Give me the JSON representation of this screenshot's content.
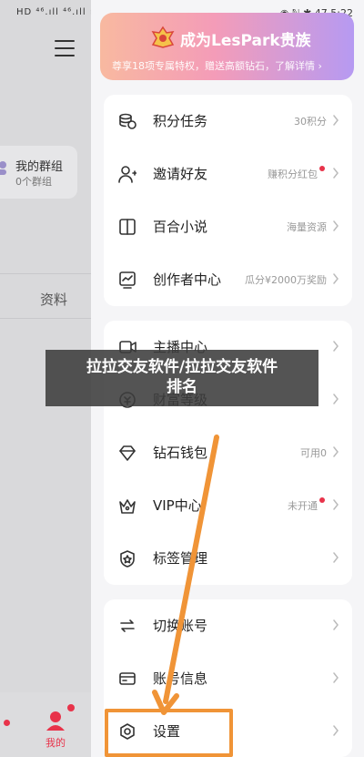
{
  "status_bar": {
    "left": "HD ⁴⁶.ıll ⁴⁶.ıll ≋ ▣",
    "right": "◉ ℕ ✱ 47 5:22"
  },
  "left_panel": {
    "group_title": "我的群组",
    "group_sub": "0个群组",
    "tab_label": "资料",
    "nav_label": "我的"
  },
  "vip_banner": {
    "title": "成为LesPark贵族",
    "subtitle": "尊享18项专属特权，赠送高额钻石，了解详情 ›"
  },
  "menu_sections": [
    [
      {
        "label": "积分任务",
        "value": "30积分",
        "icon": "coins-icon",
        "dot": false
      },
      {
        "label": "邀请好友",
        "value": "赚积分红包",
        "icon": "invite-user-icon",
        "dot": true
      },
      {
        "label": "百合小说",
        "value": "海量资源",
        "icon": "book-icon",
        "dot": false
      },
      {
        "label": "创作者中心",
        "value": "瓜分¥2000万奖励",
        "icon": "chart-icon",
        "dot": false
      }
    ],
    [
      {
        "label": "主播中心",
        "value": "",
        "icon": "video-icon",
        "dot": false
      },
      {
        "label": "财富等级",
        "value": "",
        "icon": "wealth-icon",
        "dot": false
      },
      {
        "label": "钻石钱包",
        "value": "可用0",
        "icon": "diamond-icon",
        "dot": false
      },
      {
        "label": "VIP中心",
        "value": "未开通",
        "icon": "crown-icon",
        "dot": true
      },
      {
        "label": "标签管理",
        "value": "",
        "icon": "tag-icon",
        "dot": false
      }
    ],
    [
      {
        "label": "切换账号",
        "value": "",
        "icon": "switch-icon",
        "dot": false
      },
      {
        "label": "账号信息",
        "value": "",
        "icon": "card-icon",
        "dot": false
      },
      {
        "label": "设置",
        "value": "",
        "icon": "settings-icon",
        "dot": false
      }
    ]
  ],
  "caption": {
    "line1": "拉拉交友软件/拉拉交友软件",
    "line2": "排名"
  },
  "colors": {
    "accent": "#e8334a",
    "highlight": "#f09437"
  }
}
